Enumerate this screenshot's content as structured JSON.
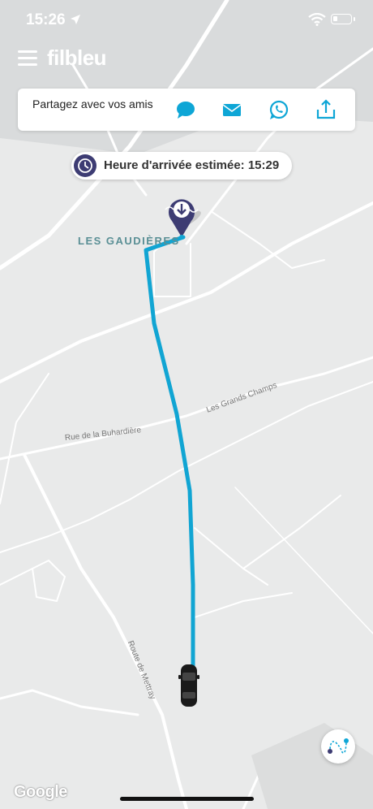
{
  "status_bar": {
    "time": "15:26"
  },
  "header": {
    "logo": "filbleu"
  },
  "share": {
    "label": "Partagez avec vos amis",
    "buttons": [
      "sms-icon",
      "mail-icon",
      "whatsapp-icon",
      "share-icon"
    ]
  },
  "eta": {
    "text": "Heure d'arrivée estimée: 15:29"
  },
  "map": {
    "place_label": "LES GAUDIÈRES",
    "streets": [
      "Rue de la Buhardière",
      "Les Grands Champs",
      "Route de Mettray"
    ],
    "attribution": "Google"
  },
  "colors": {
    "route": "#11a5d3",
    "brand_dark": "#3d3c73",
    "accent": "#0ea6d6"
  }
}
